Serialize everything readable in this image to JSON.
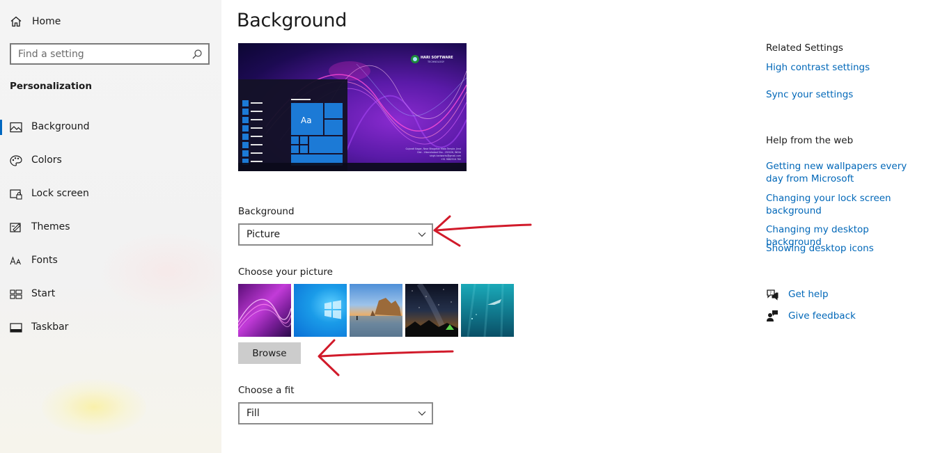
{
  "sidebar": {
    "home_label": "Home",
    "search_placeholder": "Find a setting",
    "section_title": "Personalization",
    "items": [
      {
        "label": "Background",
        "icon": "picture-icon",
        "active": true
      },
      {
        "label": "Colors",
        "icon": "palette-icon"
      },
      {
        "label": "Lock screen",
        "icon": "lock-screen-icon"
      },
      {
        "label": "Themes",
        "icon": "themes-icon"
      },
      {
        "label": "Fonts",
        "icon": "fonts-icon"
      },
      {
        "label": "Start",
        "icon": "start-icon"
      },
      {
        "label": "Taskbar",
        "icon": "taskbar-icon"
      }
    ]
  },
  "main": {
    "title": "Background",
    "preview": {
      "brand": "HARI SOFTWARE",
      "brand_sub": "TECHNOLOGY",
      "tile_text": "Aa",
      "info_lines": [
        "Gujarati Nagar, Near Bhagdhar Mata Temple, Jinst",
        "Dist - Vikarahabad Sha - 292026, INDIA",
        "singh.hariworks@gmail.com",
        "+91 9882516 780"
      ]
    },
    "background_label": "Background",
    "background_value": "Picture",
    "choose_picture_label": "Choose your picture",
    "browse_label": "Browse",
    "fit_label": "Choose a fit",
    "fit_value": "Fill"
  },
  "right": {
    "related_title": "Related Settings",
    "related_links": [
      "High contrast settings",
      "Sync your settings"
    ],
    "help_title": "Help from the web",
    "help_links": [
      "Getting new wallpapers every day from Microsoft",
      "Changing your lock screen background",
      "Changing my desktop background",
      "Showing desktop icons"
    ],
    "get_help": "Get help",
    "give_feedback": "Give feedback"
  },
  "colors": {
    "accent": "#0067c0",
    "link": "#0067b8",
    "annotation_arrow": "#d11a2a"
  }
}
